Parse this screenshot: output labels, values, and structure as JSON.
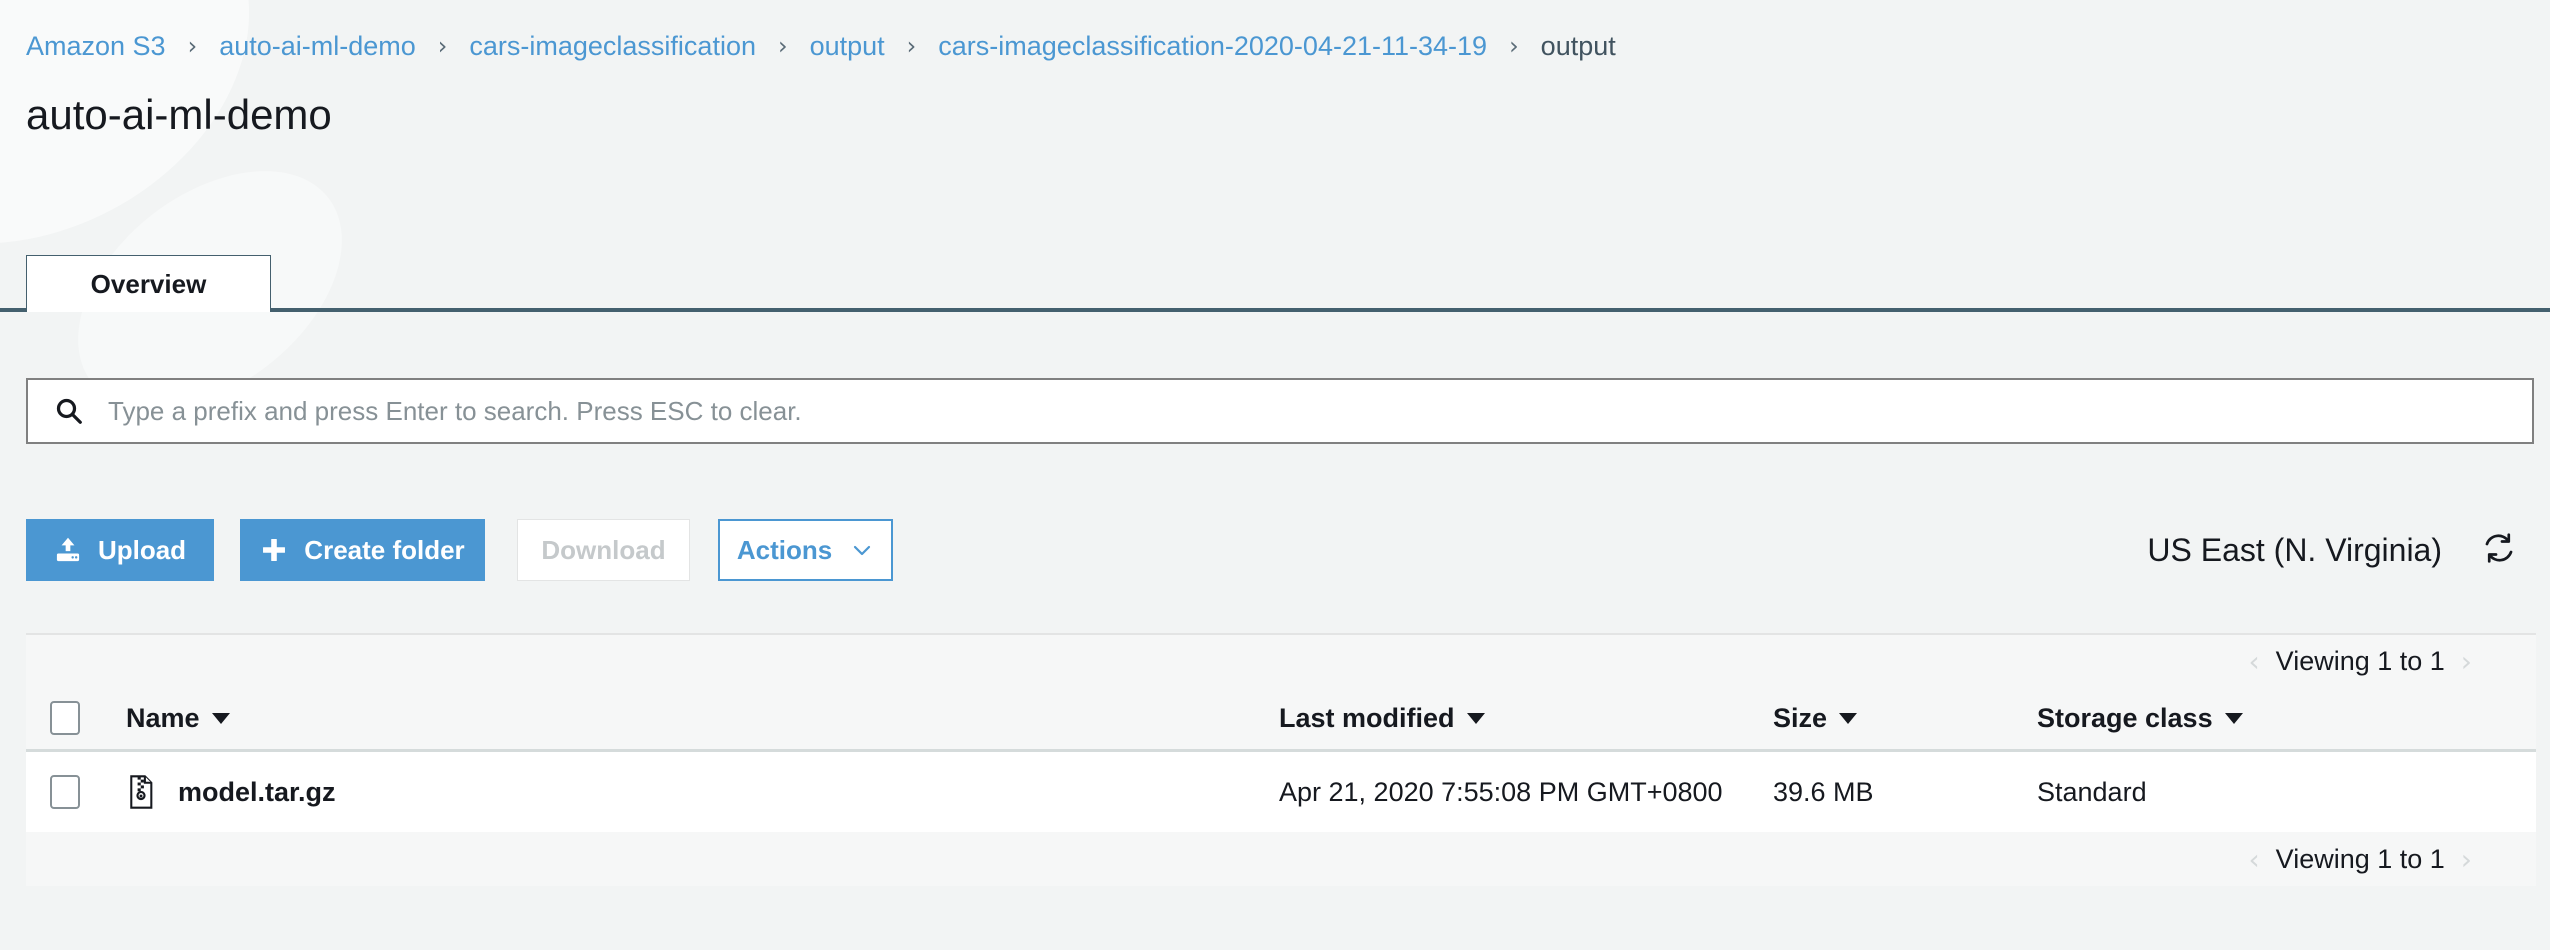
{
  "breadcrumb": {
    "separator": "›",
    "items": [
      {
        "label": "Amazon S3",
        "link": true
      },
      {
        "label": "auto-ai-ml-demo",
        "link": true
      },
      {
        "label": "cars-imageclassification",
        "link": true
      },
      {
        "label": "output",
        "link": true
      },
      {
        "label": "cars-imageclassification-2020-04-21-11-34-19",
        "link": true
      },
      {
        "label": "output",
        "link": false
      }
    ]
  },
  "page_title": "auto-ai-ml-demo",
  "tabs": [
    {
      "label": "Overview",
      "selected": true
    }
  ],
  "search": {
    "placeholder": "Type a prefix and press Enter to search. Press ESC to clear.",
    "value": "",
    "icon": "search-icon"
  },
  "toolbar": {
    "upload_label": "Upload",
    "upload_icon": "upload-icon",
    "create_folder_label": "Create folder",
    "create_folder_icon": "plus-icon",
    "download_label": "Download",
    "actions_label": "Actions",
    "actions_icon": "chevron-down-icon",
    "region_label": "US East (N. Virginia)",
    "refresh_icon": "refresh-icon"
  },
  "pagination": {
    "top_label": "Viewing 1 to 1",
    "bottom_label": "Viewing 1 to 1",
    "prev_icon": "chevron-left-icon",
    "next_icon": "chevron-right-icon"
  },
  "table": {
    "select_all_checkbox": false,
    "columns": [
      {
        "label": "Name",
        "sortable": true
      },
      {
        "label": "Last modified",
        "sortable": true
      },
      {
        "label": "Size",
        "sortable": true
      },
      {
        "label": "Storage class",
        "sortable": true
      }
    ],
    "rows": [
      {
        "checked": false,
        "icon": "archive-file-icon",
        "name": "model.tar.gz",
        "last_modified": "Apr 21, 2020 7:55:08 PM GMT+0800",
        "size": "39.6 MB",
        "storage_class": "Standard"
      }
    ]
  },
  "colors": {
    "link": "#4b97d2",
    "primary_button": "#4b97d2",
    "tab_underline": "#44606e",
    "page_background": "#f2f4f4",
    "row_background": "#ffffff",
    "header_background": "#f6f7f7",
    "disabled_text": "#c5c9cb",
    "placeholder_text": "#879196"
  }
}
